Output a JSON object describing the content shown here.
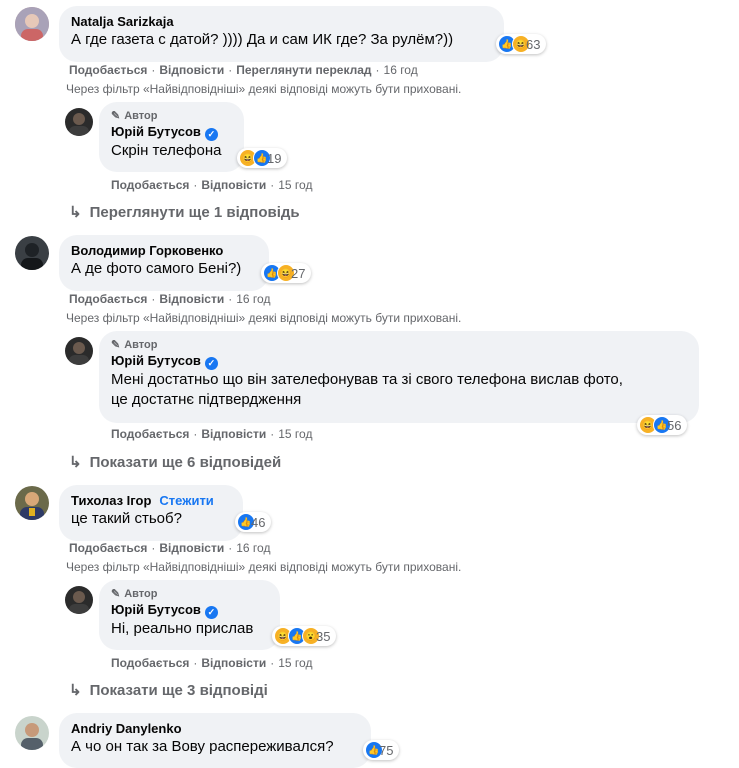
{
  "labels": {
    "like": "Подобається",
    "reply": "Відповісти",
    "translate": "Переглянути переклад",
    "author": "Автор",
    "filter_note": "Через фільтр «Найвідповідніші» деякі відповіді можуть бути приховані.",
    "follow": "Стежити",
    "dot": "·",
    "reply_arrow": "↳",
    "pencil": "✎",
    "check": "✓"
  },
  "comments": [
    {
      "name": "Natalja Sarizkaja",
      "text": "А где газета с датой? )))) Да и сам ИК где? За рулём?))",
      "reactions": 63,
      "time": "16 год",
      "reply": {
        "name": "Юрій Бутусов",
        "text": "Скрін телефона",
        "reactions": 19,
        "time": "15 год"
      },
      "more": "Переглянути ще 1 відповідь"
    },
    {
      "name": "Володимир Горковенко",
      "text": "А де фото самого Бені?)",
      "reactions": 27,
      "time": "16 год",
      "reply": {
        "name": "Юрій Бутусов",
        "text_line1": "Мені достатньо що він зателефонував та зі свого телефона вислав фото,",
        "text_line2": "це достатнє підтвердження",
        "reactions": 56,
        "time": "15 год"
      },
      "more": "Показати ще 6 відповідей"
    },
    {
      "name": "Тихолаз Ігор",
      "text": "це такий стьоб?",
      "reactions": 46,
      "time": "16 год",
      "reply": {
        "name": "Юрій Бутусов",
        "text": "Ні, реально прислав",
        "reactions": 35,
        "time": "15 год"
      },
      "more": "Показати ще 3 відповіді"
    },
    {
      "name": "Andriy Danylenko",
      "text": "А чо он так за Вову распереживался?",
      "reactions": 75
    }
  ],
  "colors": {
    "bubble": "#f0f2f5",
    "meta": "#65676b",
    "accent": "#1877f2",
    "haha": "#f7b125"
  }
}
